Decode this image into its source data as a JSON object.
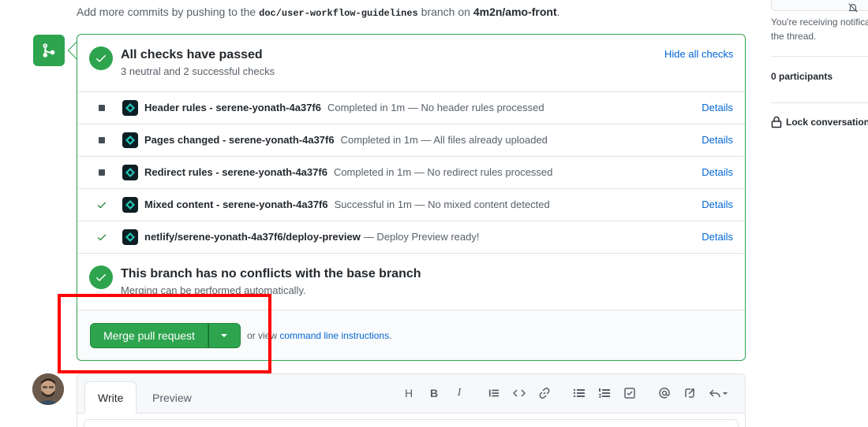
{
  "intro": {
    "prefix": "Add more commits by pushing to the",
    "branch": "doc/user-workflow-guidelines",
    "middle": "branch on",
    "repo": "4m2n/amo-front",
    "suffix": "."
  },
  "checks_section": {
    "title": "All checks have passed",
    "subtitle": "3 neutral and 2 successful checks",
    "hide_link": "Hide all checks"
  },
  "checks": [
    {
      "status": "neutral",
      "name": "Header rules - serene-yonath-4a37f6",
      "description": "Completed in 1m — No header rules processed",
      "details": "Details"
    },
    {
      "status": "neutral",
      "name": "Pages changed - serene-yonath-4a37f6",
      "description": "Completed in 1m — All files already uploaded",
      "details": "Details"
    },
    {
      "status": "neutral",
      "name": "Redirect rules - serene-yonath-4a37f6",
      "description": "Completed in 1m — No redirect rules processed",
      "details": "Details"
    },
    {
      "status": "success",
      "name": "Mixed content - serene-yonath-4a37f6",
      "description": "Successful in 1m — No mixed content detected",
      "details": "Details"
    },
    {
      "status": "success",
      "name": "netlify/serene-yonath-4a37f6/deploy-preview",
      "description": "— Deploy Preview ready!",
      "details": "Details"
    }
  ],
  "conflict": {
    "title": "This branch has no conflicts with the base branch",
    "subtitle": "Merging can be performed automatically."
  },
  "merge": {
    "button_label": "Merge pull request",
    "or_view": "or view",
    "cli_link": "command line instructions",
    "period": "."
  },
  "editor": {
    "tab_write": "Write",
    "tab_preview": "Preview"
  },
  "sidebar": {
    "notification_text_1": "You're receiving notifica",
    "notification_text_2": "the thread.",
    "participants": "0 participants",
    "lock": "Lock conversation"
  },
  "colors": {
    "success": "#2ea44f",
    "link": "#0366d6",
    "highlight": "#ff0000"
  }
}
